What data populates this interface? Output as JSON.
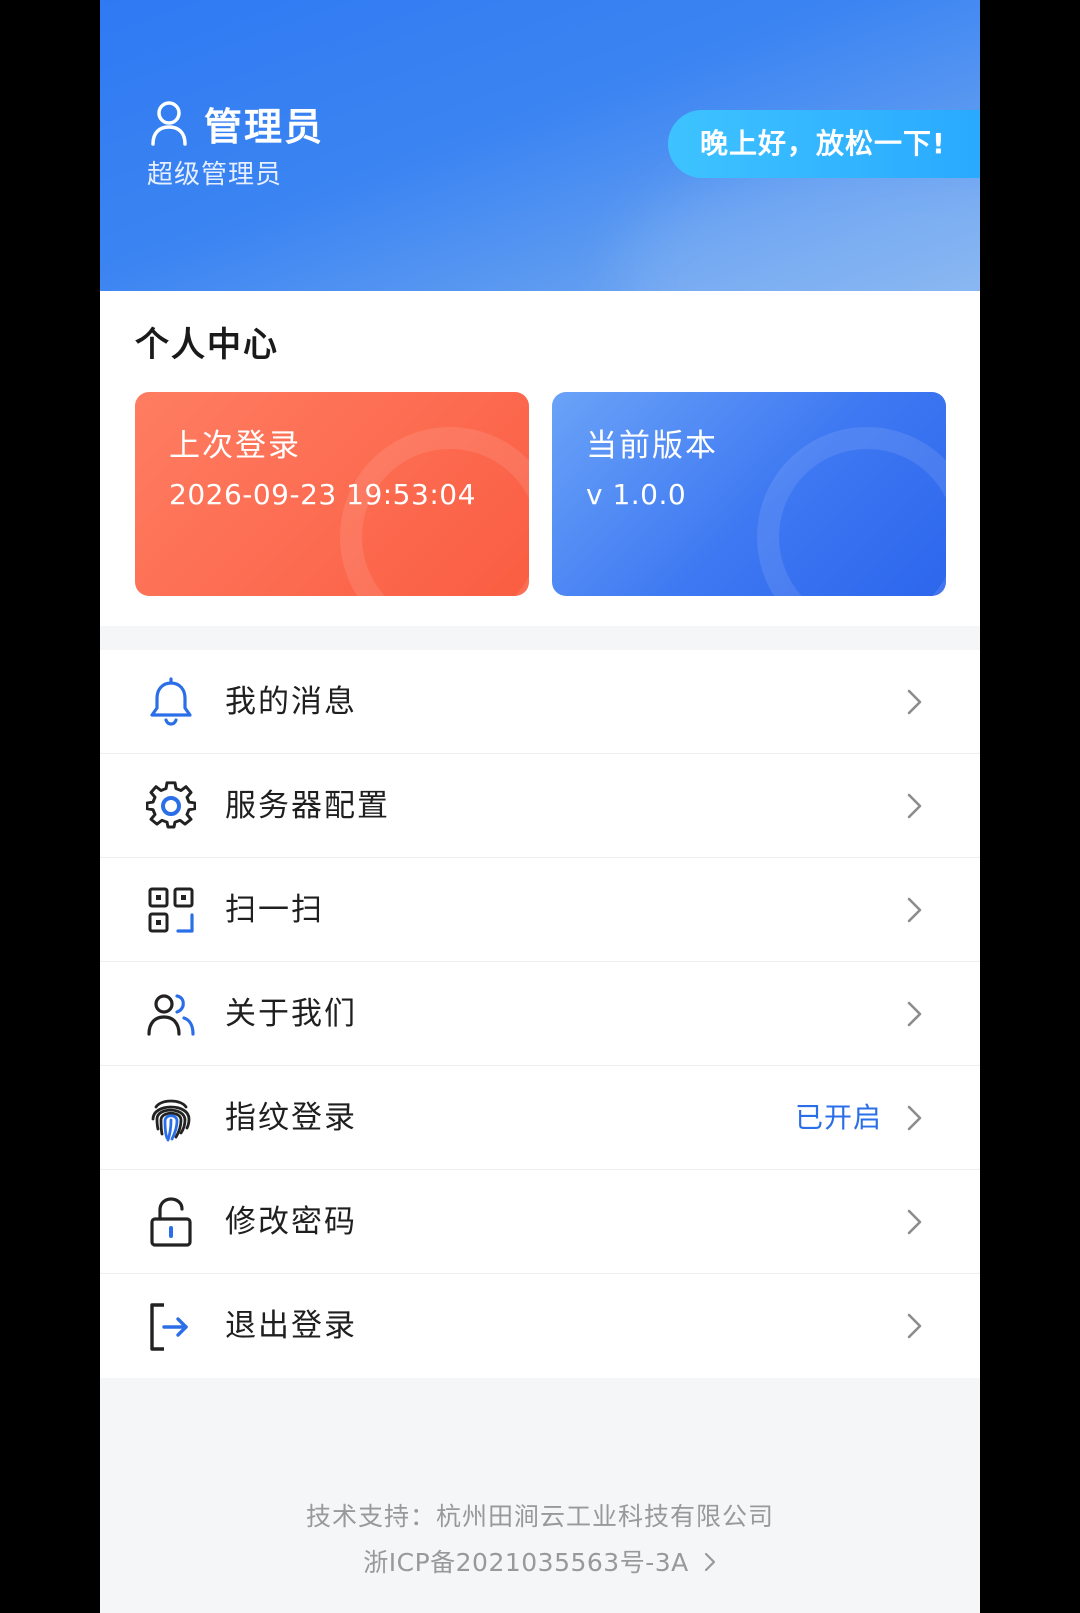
{
  "header": {
    "user_name": "管理员",
    "user_role": "超级管理员",
    "greeting": "晚上好，放松一下!"
  },
  "personal_center": {
    "title": "个人中心",
    "cards": [
      {
        "title": "上次登录",
        "value": "2026-09-23 19:53:04"
      },
      {
        "title": "当前版本",
        "value": "v 1.0.0"
      }
    ]
  },
  "menu": {
    "items": [
      {
        "label": "我的消息",
        "icon": "bell-icon"
      },
      {
        "label": "服务器配置",
        "icon": "gear-icon"
      },
      {
        "label": "扫一扫",
        "icon": "qr-scan-icon"
      },
      {
        "label": "关于我们",
        "icon": "users-icon"
      },
      {
        "label": "指纹登录",
        "icon": "fingerprint-icon",
        "status": "已开启"
      },
      {
        "label": "修改密码",
        "icon": "unlock-icon"
      },
      {
        "label": "退出登录",
        "icon": "logout-icon"
      }
    ]
  },
  "footer": {
    "support": "技术支持：杭州田涧云工业科技有限公司",
    "icp": "浙ICP备2021035563号-3A"
  },
  "colors": {
    "primary_blue": "#2f7af3",
    "accent_blue": "#2b6fe8",
    "login_card": "#fa5d42",
    "version_card": "#3e78f2"
  }
}
